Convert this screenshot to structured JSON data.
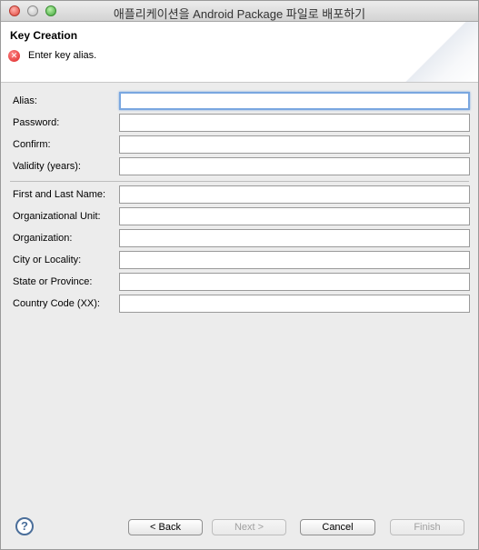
{
  "window": {
    "title": "애플리케이션을 Android Package 파일로 배포하기"
  },
  "banner": {
    "title": "Key Creation",
    "message": "Enter key alias.",
    "icon": "error-icon"
  },
  "form": {
    "fields": [
      {
        "label": "Alias:",
        "value": ""
      },
      {
        "label": "Password:",
        "value": ""
      },
      {
        "label": "Confirm:",
        "value": ""
      },
      {
        "label": "Validity (years):",
        "value": ""
      },
      {
        "label": "First and Last Name:",
        "value": ""
      },
      {
        "label": "Organizational Unit:",
        "value": ""
      },
      {
        "label": "Organization:",
        "value": ""
      },
      {
        "label": "City or Locality:",
        "value": ""
      },
      {
        "label": "State or Province:",
        "value": ""
      },
      {
        "label": "Country Code (XX):",
        "value": ""
      }
    ]
  },
  "buttons": {
    "help": "?",
    "back": "< Back",
    "next": "Next >",
    "cancel": "Cancel",
    "finish": "Finish"
  }
}
